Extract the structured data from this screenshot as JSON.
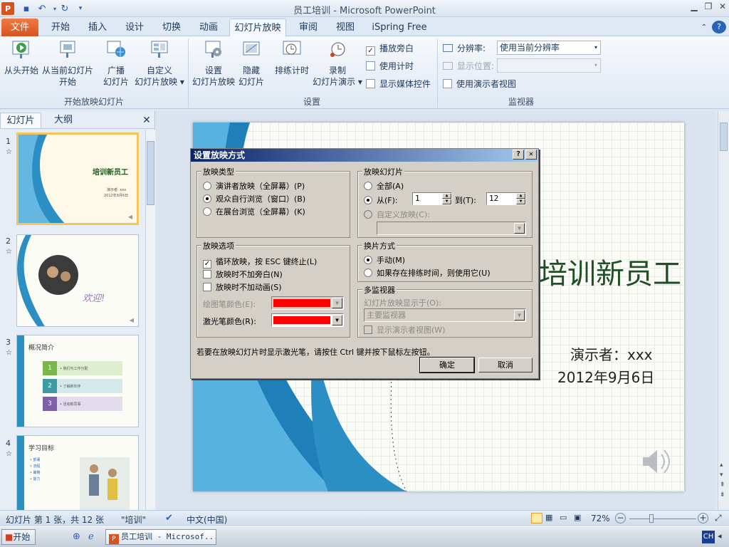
{
  "app": {
    "title": "员工培训 - Microsoft PowerPoint",
    "accent": "#d9531e"
  },
  "tabs": [
    "文件",
    "开始",
    "插入",
    "设计",
    "切换",
    "动画",
    "幻灯片放映",
    "审阅",
    "视图",
    "iSpring Free"
  ],
  "ribbon": {
    "groups": {
      "start": "开始放映幻灯片",
      "setup": "设置",
      "monitors": "监视器"
    },
    "from_start": "从头开始",
    "from_current": [
      "从当前幻灯片",
      "开始"
    ],
    "broadcast": [
      "广播",
      "幻灯片"
    ],
    "custom": [
      "自定义",
      "幻灯片放映 ▾"
    ],
    "setup_show": [
      "设置",
      "幻灯片放映"
    ],
    "hide_slide": [
      "隐藏",
      "幻灯片"
    ],
    "rehearse": "排练计时",
    "record": [
      "录制",
      "幻灯片演示 ▾"
    ],
    "play_narration": "播放旁白",
    "use_timings": "使用计时",
    "show_media": "显示媒体控件",
    "resolution_label": "分辨率:",
    "resolution_value": "使用当前分辨率",
    "show_on_label": "显示位置:",
    "presenter_view": "使用演示者视图"
  },
  "panel": {
    "tab_slides": "幻灯片",
    "tab_outline": "大纲",
    "close": "✕"
  },
  "thumbnails": [
    {
      "num": "1",
      "title": "培训新员工",
      "sub1": "演示者: xxx",
      "sub2": "2012年9月6日"
    },
    {
      "num": "2",
      "title": "欢迎!"
    },
    {
      "num": "3",
      "title": "概况简介",
      "items": [
        "1",
        "2",
        "3"
      ],
      "texts": [
        "• 我们与工作分配",
        "• 了解新伙伴",
        "• 活动新同事"
      ]
    },
    {
      "num": "4",
      "title": "学习目标",
      "bullets": [
        "• 部署",
        "• 流程",
        "• 策略",
        "• 能力"
      ]
    }
  ],
  "slide": {
    "title": "培训新员工",
    "presenter": "演示者：xxx",
    "date": "2012年9月6日"
  },
  "dialog": {
    "title": "设置放映方式",
    "help": "?",
    "close": "✕",
    "type_group": "放映类型",
    "type_options": [
      "演讲者放映（全屏幕）(P)",
      "观众自行浏览（窗口）(B)",
      "在展台浏览（全屏幕）(K)"
    ],
    "type_selected": 1,
    "slides_group": "放映幻灯片",
    "all": "全部(A)",
    "from": "从(F):",
    "from_value": "1",
    "to": "到(T):",
    "to_value": "12",
    "custom_show": "自定义放映(C):",
    "options_group": "放映选项",
    "loop": "循环放映，按 ESC 键终止(L)",
    "no_narration": "放映时不加旁白(N)",
    "no_animation": "放映时不加动画(S)",
    "pen_color": "绘图笔颜色(E):",
    "laser_color": "激光笔颜色(R):",
    "pen_swatch": "#ff0000",
    "laser_swatch": "#ff0000",
    "advance_group": "换片方式",
    "manual": "手动(M)",
    "timings": "如果存在排练时间，则使用它(U)",
    "monitors_group": "多监视器",
    "show_on": "幻灯片放映显示于(O):",
    "primary_monitor": "主要监视器",
    "presenter_view": "显示演示者视图(W)",
    "hint": "若要在放映幻灯片时显示激光笔，请按住 Ctrl 键并按下鼠标左按钮。",
    "ok": "确定",
    "cancel": "取消"
  },
  "status": {
    "slide": "幻灯片 第 1 张，共 12 张",
    "theme": "\"培训\"",
    "lang": "中文(中国)",
    "zoom": "72%"
  },
  "taskbar": {
    "start": "开始",
    "task": "员工培训 - Microsof...",
    "ime": "CH"
  }
}
